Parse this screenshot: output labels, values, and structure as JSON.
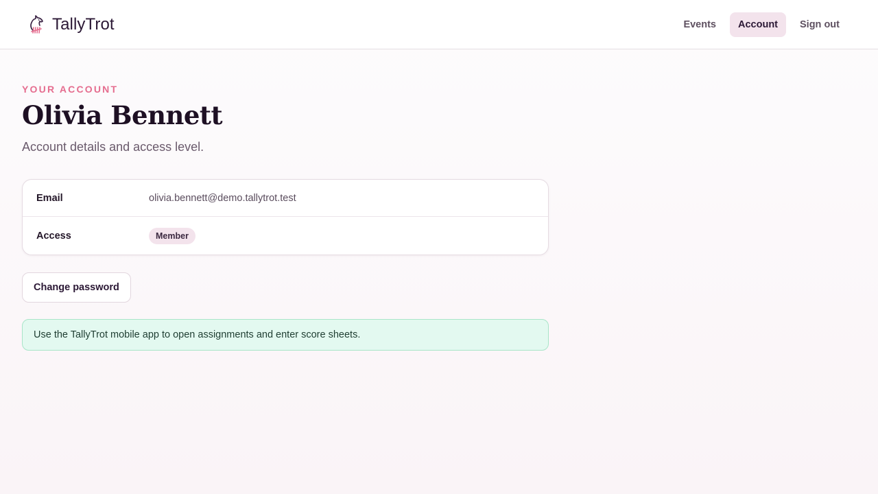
{
  "brand": {
    "name": "TallyTrot",
    "logo_icon": "horse-head-tally-icon"
  },
  "nav": {
    "items": [
      {
        "label": "Events",
        "active": false
      },
      {
        "label": "Account",
        "active": true
      },
      {
        "label": "Sign out",
        "active": false
      }
    ]
  },
  "page": {
    "eyebrow": "YOUR ACCOUNT",
    "title": "Olivia Bennett",
    "subtitle": "Account details and access level."
  },
  "details": {
    "email_label": "Email",
    "email_value": "olivia.bennett@demo.tallytrot.test",
    "access_label": "Access",
    "access_value": "Member"
  },
  "actions": {
    "change_password_label": "Change password"
  },
  "notice": {
    "text": "Use the TallyTrot mobile app to open assignments and enter score sheets."
  },
  "colors": {
    "accent": "#e56d8f",
    "active_nav_bg": "#f3e3ec",
    "notice_bg": "#e3f9f0",
    "notice_border": "#a8e5c8"
  }
}
